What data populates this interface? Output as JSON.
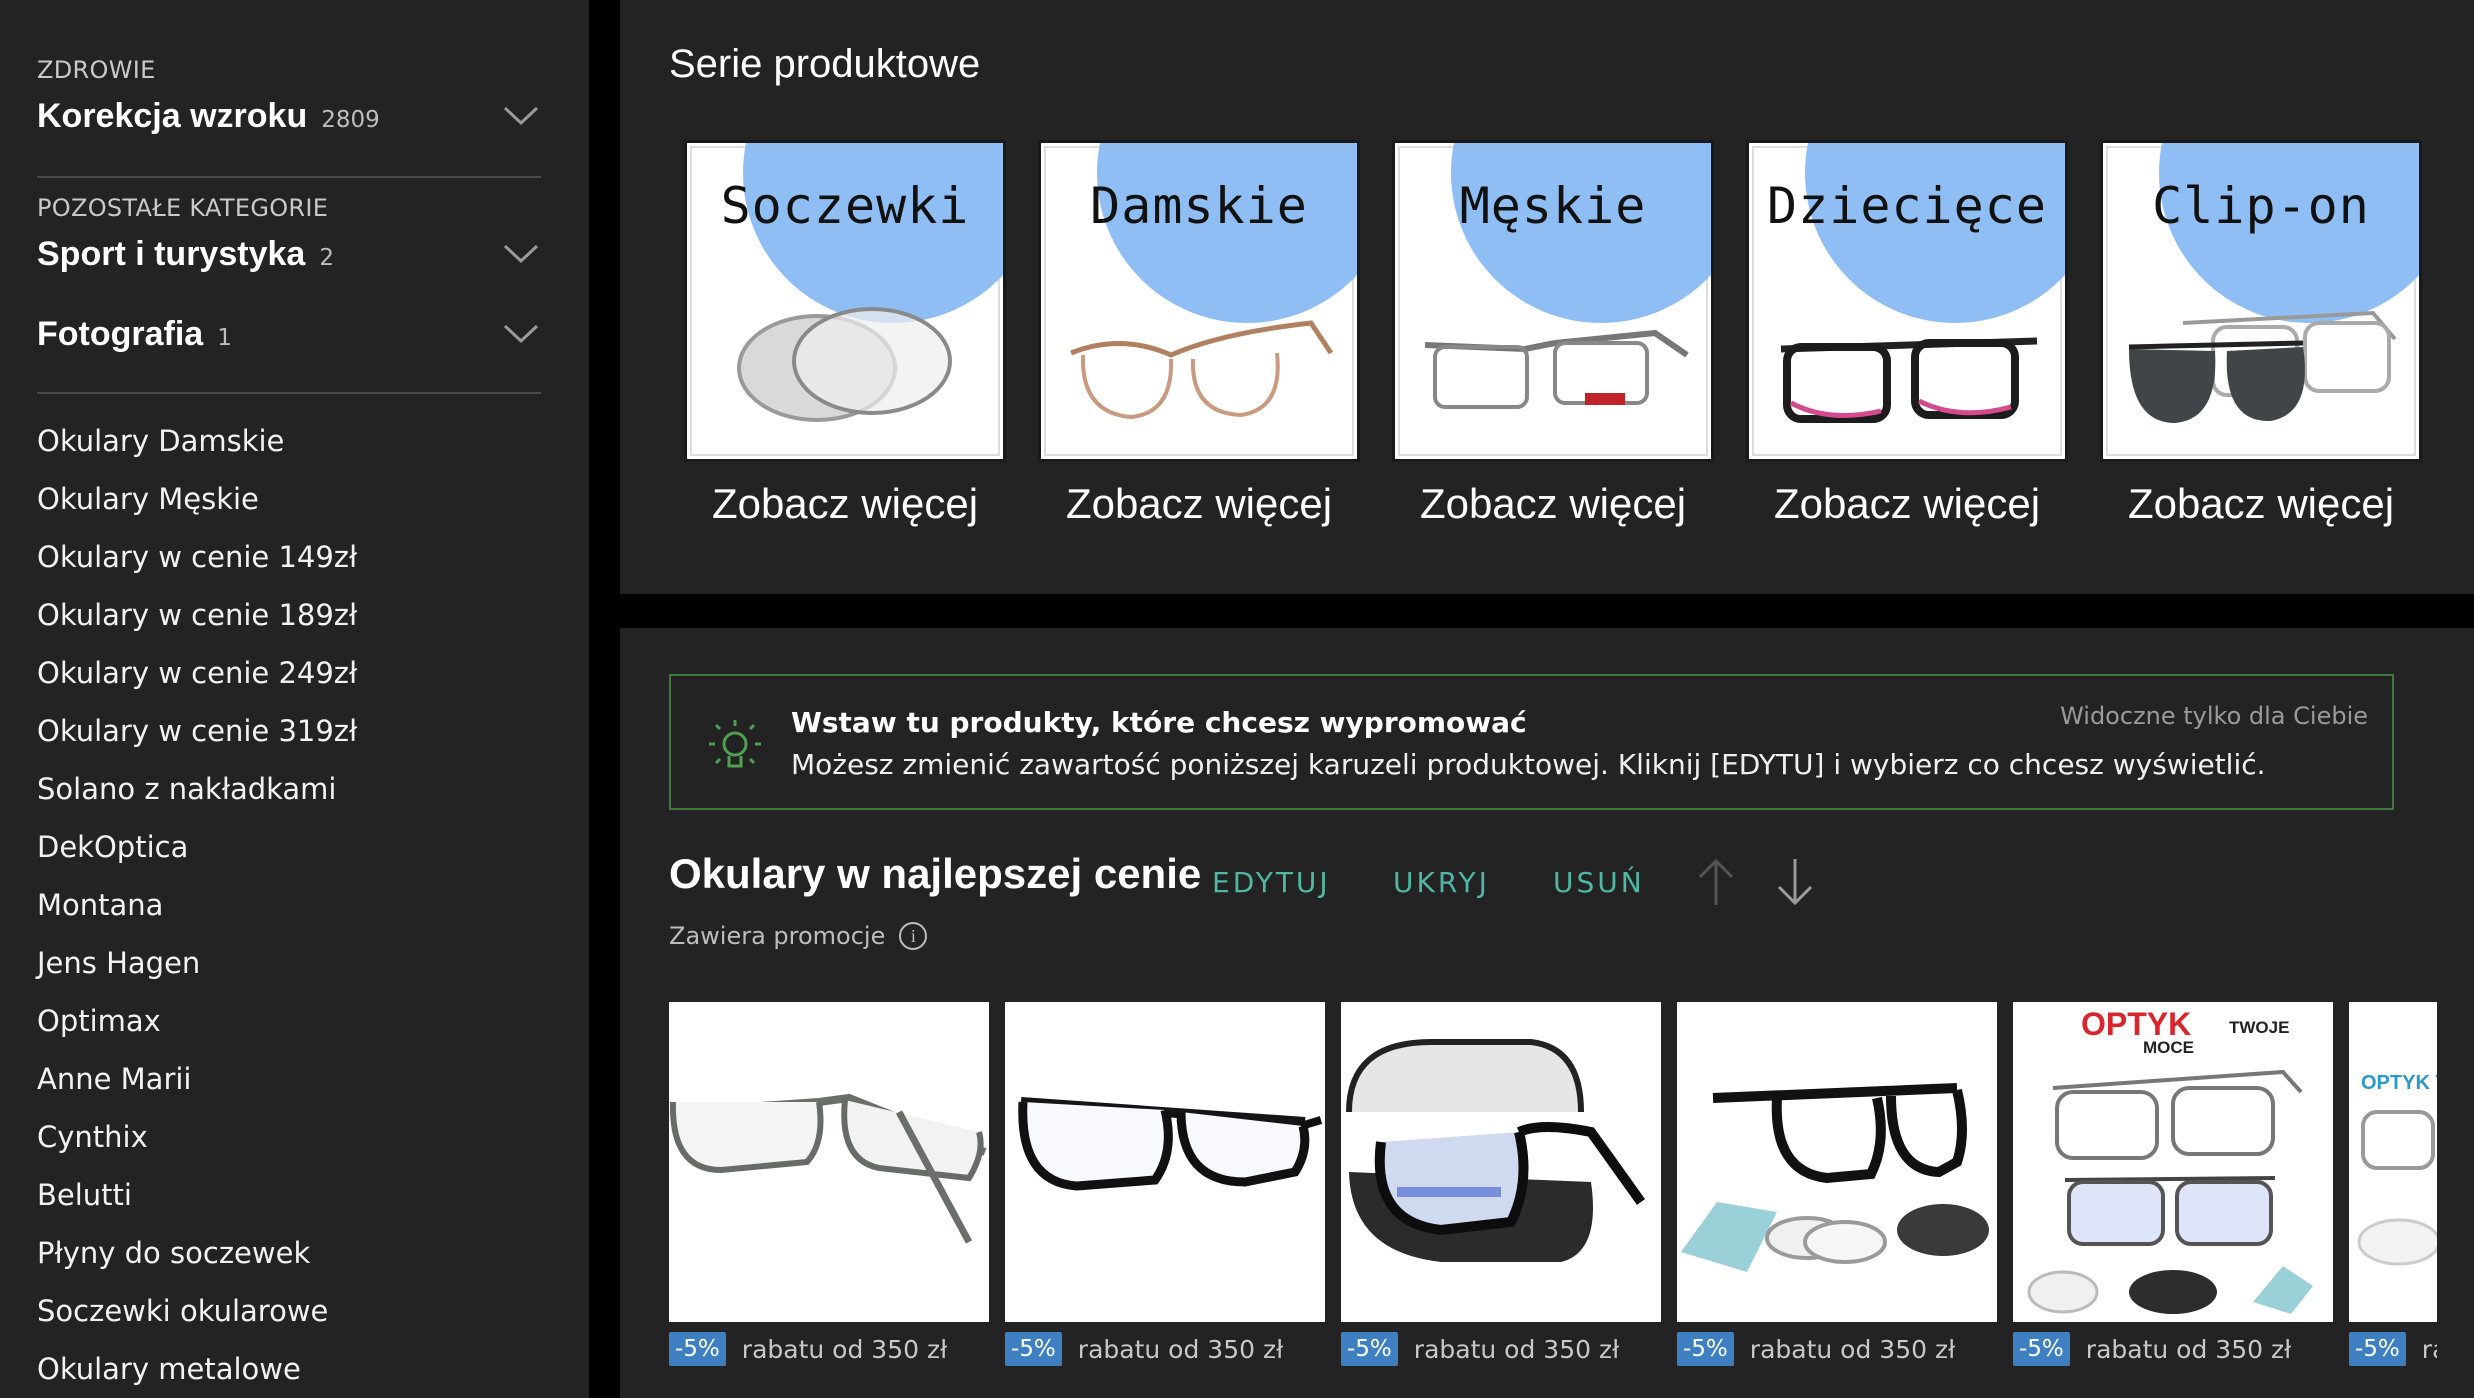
{
  "sidebar": {
    "health_kicker": "ZDROWIE",
    "main_category": {
      "name": "Korekcja wzroku",
      "count": "2809"
    },
    "other_kicker": "POZOSTAŁE KATEGORIE",
    "other_categories": [
      {
        "name": "Sport i turystyka",
        "count": "2"
      },
      {
        "name": "Fotografia",
        "count": "1"
      }
    ],
    "links": [
      "Okulary Damskie",
      "Okulary Męskie",
      "Okulary w cenie 149zł",
      "Okulary w cenie 189zł",
      "Okulary w cenie 249zł",
      "Okulary w cenie 319zł",
      "Solano z nakładkami",
      "DekOptica",
      "Montana",
      "Jens Hagen",
      "Optimax",
      "Anne Marii",
      "Cynthix",
      "Belutti",
      "Płyny do soczewek",
      "Soczewki okularowe",
      "Okulary metalowe"
    ]
  },
  "series_section": {
    "title": "Serie produktowe",
    "items": [
      {
        "label": "Soczewki",
        "more": "Zobacz więcej"
      },
      {
        "label": "Damskie",
        "more": "Zobacz więcej"
      },
      {
        "label": "Męskie",
        "more": "Zobacz więcej"
      },
      {
        "label": "Dziecięce",
        "more": "Zobacz więcej"
      },
      {
        "label": "Clip-on",
        "more": "Zobacz więcej"
      }
    ]
  },
  "promo_box": {
    "heading": "Wstaw tu produkty, które chcesz wypromować",
    "text": "Możesz zmienić zawartość poniższej karuzeli produktowej. Kliknij [EDYTU] i wybierz co chcesz wyświetlić.",
    "visibility": "Widoczne tylko dla Ciebie"
  },
  "carousel": {
    "title": "Okulary w najlepszej cenie",
    "actions": {
      "edit": "EDYTUJ",
      "hide": "UKRYJ",
      "remove": "USUŃ"
    },
    "note": "Zawiera promocje",
    "info_glyph": "i",
    "products": [
      {
        "badge": "-5%",
        "discount_text": "rabatu od 350 zł"
      },
      {
        "badge": "-5%",
        "discount_text": "rabatu od 350 zł"
      },
      {
        "badge": "-5%",
        "discount_text": "rabatu od 350 zł"
      },
      {
        "badge": "-5%",
        "discount_text": "rabatu od 350 zł"
      },
      {
        "badge": "-5%",
        "discount_text": "rabatu od 350 zł",
        "img_text_brand": "OPTYK",
        "img_text_tw": "TWOJE",
        "img_text_moce": "MOCE"
      },
      {
        "badge": "-5%",
        "discount_text": "ra",
        "img_text_brand": "OPTYK T"
      }
    ]
  },
  "colors": {
    "accent_teal": "#4fb7a5",
    "badge_blue": "#3d7fc1",
    "promo_border": "#3c7a3c",
    "tile_blob": "#8fbef4"
  }
}
